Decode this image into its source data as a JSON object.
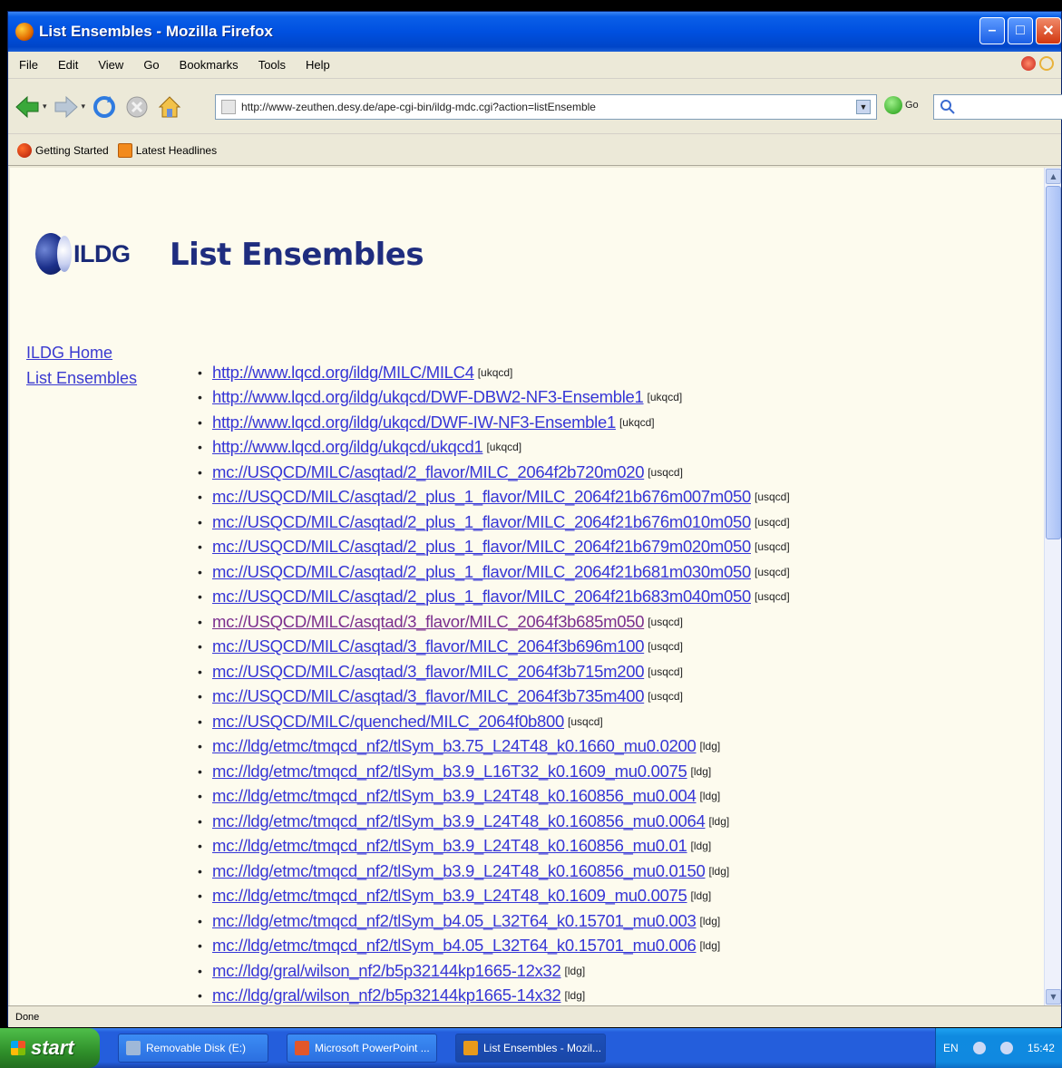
{
  "window": {
    "title": "List Ensembles - Mozilla Firefox"
  },
  "menu": [
    "File",
    "Edit",
    "View",
    "Go",
    "Bookmarks",
    "Tools",
    "Help"
  ],
  "navbar": {
    "url": "http://www-zeuthen.desy.de/ape-cgi-bin/ildg-mdc.cgi?action=listEnsemble",
    "go_label": "Go"
  },
  "bookmarks": [
    {
      "label": "Getting Started"
    },
    {
      "label": "Latest Headlines"
    }
  ],
  "page": {
    "logo_text": "ILDG",
    "title": "List Ensembles",
    "sidenav": [
      "ILDG Home",
      "List Ensembles"
    ],
    "ensembles": [
      {
        "uri": "http://www.lqcd.org/ildg/MILC/MILC4",
        "group": "[ukqcd]",
        "visited": false
      },
      {
        "uri": "http://www.lqcd.org/ildg/ukqcd/DWF-DBW2-NF3-Ensemble1",
        "group": "[ukqcd]",
        "visited": false
      },
      {
        "uri": "http://www.lqcd.org/ildg/ukqcd/DWF-IW-NF3-Ensemble1",
        "group": "[ukqcd]",
        "visited": false
      },
      {
        "uri": "http://www.lqcd.org/ildg/ukqcd/ukqcd1",
        "group": "[ukqcd]",
        "visited": false
      },
      {
        "uri": "mc://USQCD/MILC/asqtad/2_flavor/MILC_2064f2b720m020",
        "group": "[usqcd]",
        "visited": false
      },
      {
        "uri": "mc://USQCD/MILC/asqtad/2_plus_1_flavor/MILC_2064f21b676m007m050",
        "group": "[usqcd]",
        "visited": false
      },
      {
        "uri": "mc://USQCD/MILC/asqtad/2_plus_1_flavor/MILC_2064f21b676m010m050",
        "group": "[usqcd]",
        "visited": false
      },
      {
        "uri": "mc://USQCD/MILC/asqtad/2_plus_1_flavor/MILC_2064f21b679m020m050",
        "group": "[usqcd]",
        "visited": false
      },
      {
        "uri": "mc://USQCD/MILC/asqtad/2_plus_1_flavor/MILC_2064f21b681m030m050",
        "group": "[usqcd]",
        "visited": false
      },
      {
        "uri": "mc://USQCD/MILC/asqtad/2_plus_1_flavor/MILC_2064f21b683m040m050",
        "group": "[usqcd]",
        "visited": false
      },
      {
        "uri": "mc://USQCD/MILC/asqtad/3_flavor/MILC_2064f3b685m050",
        "group": "[usqcd]",
        "visited": true
      },
      {
        "uri": "mc://USQCD/MILC/asqtad/3_flavor/MILC_2064f3b696m100",
        "group": "[usqcd]",
        "visited": false
      },
      {
        "uri": "mc://USQCD/MILC/asqtad/3_flavor/MILC_2064f3b715m200",
        "group": "[usqcd]",
        "visited": false
      },
      {
        "uri": "mc://USQCD/MILC/asqtad/3_flavor/MILC_2064f3b735m400",
        "group": "[usqcd]",
        "visited": false
      },
      {
        "uri": "mc://USQCD/MILC/quenched/MILC_2064f0b800",
        "group": "[usqcd]",
        "visited": false
      },
      {
        "uri": "mc://ldg/etmc/tmqcd_nf2/tlSym_b3.75_L24T48_k0.1660_mu0.0200",
        "group": "[ldg]",
        "visited": false
      },
      {
        "uri": "mc://ldg/etmc/tmqcd_nf2/tlSym_b3.9_L16T32_k0.1609_mu0.0075",
        "group": "[ldg]",
        "visited": false
      },
      {
        "uri": "mc://ldg/etmc/tmqcd_nf2/tlSym_b3.9_L24T48_k0.160856_mu0.004",
        "group": "[ldg]",
        "visited": false
      },
      {
        "uri": "mc://ldg/etmc/tmqcd_nf2/tlSym_b3.9_L24T48_k0.160856_mu0.0064",
        "group": "[ldg]",
        "visited": false
      },
      {
        "uri": "mc://ldg/etmc/tmqcd_nf2/tlSym_b3.9_L24T48_k0.160856_mu0.01",
        "group": "[ldg]",
        "visited": false
      },
      {
        "uri": "mc://ldg/etmc/tmqcd_nf2/tlSym_b3.9_L24T48_k0.160856_mu0.0150",
        "group": "[ldg]",
        "visited": false
      },
      {
        "uri": "mc://ldg/etmc/tmqcd_nf2/tlSym_b3.9_L24T48_k0.1609_mu0.0075",
        "group": "[ldg]",
        "visited": false
      },
      {
        "uri": "mc://ldg/etmc/tmqcd_nf2/tlSym_b4.05_L32T64_k0.15701_mu0.003",
        "group": "[ldg]",
        "visited": false
      },
      {
        "uri": "mc://ldg/etmc/tmqcd_nf2/tlSym_b4.05_L32T64_k0.15701_mu0.006",
        "group": "[ldg]",
        "visited": false
      },
      {
        "uri": "mc://ldg/gral/wilson_nf2/b5p32144kp1665-12x32",
        "group": "[ldg]",
        "visited": false
      },
      {
        "uri": "mc://ldg/gral/wilson_nf2/b5p32144kp1665-14x32",
        "group": "[ldg]",
        "visited": false
      }
    ]
  },
  "status": "Done",
  "taskbar": {
    "start_label": "start",
    "tasks": [
      {
        "label": "Removable Disk (E:)",
        "active": false,
        "icon_color": "#9fb8d8"
      },
      {
        "label": "Microsoft PowerPoint ...",
        "active": false,
        "icon_color": "#e2572a"
      },
      {
        "label": "List Ensembles - Mozil...",
        "active": true,
        "icon_color": "#e89a1c"
      }
    ],
    "tray_lang": "EN",
    "clock": "15:42"
  },
  "colors": {
    "link": "#3636d6",
    "visited_link": "#7b2f8f",
    "page_bg": "#fdfbee",
    "title": "#1f2d7f"
  }
}
